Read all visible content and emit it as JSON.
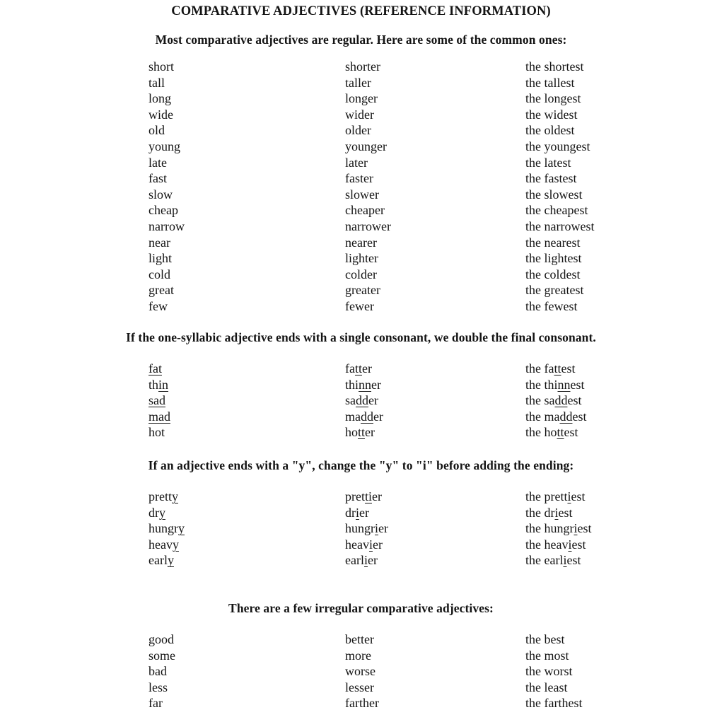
{
  "title": "COMPARATIVE ADJECTIVES (REFERENCE INFORMATION)",
  "sections": [
    {
      "heading": "Most comparative adjectives are regular. Here are some of the common ones:",
      "rows": [
        [
          [
            {
              "t": "short"
            }
          ],
          [
            {
              "t": "shorter"
            }
          ],
          [
            {
              "t": "the shortest"
            }
          ]
        ],
        [
          [
            {
              "t": "tall"
            }
          ],
          [
            {
              "t": "taller"
            }
          ],
          [
            {
              "t": "the tallest"
            }
          ]
        ],
        [
          [
            {
              "t": "long"
            }
          ],
          [
            {
              "t": "longer"
            }
          ],
          [
            {
              "t": "the longest"
            }
          ]
        ],
        [
          [
            {
              "t": "wide"
            }
          ],
          [
            {
              "t": "wider"
            }
          ],
          [
            {
              "t": "the widest"
            }
          ]
        ],
        [
          [
            {
              "t": "old"
            }
          ],
          [
            {
              "t": "older"
            }
          ],
          [
            {
              "t": "the oldest"
            }
          ]
        ],
        [
          [
            {
              "t": "young"
            }
          ],
          [
            {
              "t": "younger"
            }
          ],
          [
            {
              "t": "the youngest"
            }
          ]
        ],
        [
          [
            {
              "t": "late"
            }
          ],
          [
            {
              "t": "later"
            }
          ],
          [
            {
              "t": "the latest"
            }
          ]
        ],
        [
          [
            {
              "t": "fast"
            }
          ],
          [
            {
              "t": "faster"
            }
          ],
          [
            {
              "t": "the fastest"
            }
          ]
        ],
        [
          [
            {
              "t": "slow"
            }
          ],
          [
            {
              "t": "slower"
            }
          ],
          [
            {
              "t": "the slowest"
            }
          ]
        ],
        [
          [
            {
              "t": "cheap"
            }
          ],
          [
            {
              "t": "cheaper"
            }
          ],
          [
            {
              "t": "the cheapest"
            }
          ]
        ],
        [
          [
            {
              "t": "narrow"
            }
          ],
          [
            {
              "t": "narrower"
            }
          ],
          [
            {
              "t": "the narrowest"
            }
          ]
        ],
        [
          [
            {
              "t": "near"
            }
          ],
          [
            {
              "t": "nearer"
            }
          ],
          [
            {
              "t": "the nearest"
            }
          ]
        ],
        [
          [
            {
              "t": "light"
            }
          ],
          [
            {
              "t": "lighter"
            }
          ],
          [
            {
              "t": "the lightest"
            }
          ]
        ],
        [
          [
            {
              "t": "cold"
            }
          ],
          [
            {
              "t": "colder"
            }
          ],
          [
            {
              "t": "the coldest"
            }
          ]
        ],
        [
          [
            {
              "t": "great"
            }
          ],
          [
            {
              "t": "greater"
            }
          ],
          [
            {
              "t": "the greatest"
            }
          ]
        ],
        [
          [
            {
              "t": "few"
            }
          ],
          [
            {
              "t": "fewer"
            }
          ],
          [
            {
              "t": "the fewest"
            }
          ]
        ]
      ]
    },
    {
      "heading": "If the one-syllabic adjective ends with a single consonant, we double the final consonant.",
      "rows": [
        [
          [
            {
              "t": "fat",
              "u": true
            }
          ],
          [
            {
              "t": "fa"
            },
            {
              "t": "tt",
              "u": true
            },
            {
              "t": "er"
            }
          ],
          [
            {
              "t": "the fa"
            },
            {
              "t": "tt",
              "u": true
            },
            {
              "t": "est"
            }
          ]
        ],
        [
          [
            {
              "t": "th"
            },
            {
              "t": "in",
              "u": true
            }
          ],
          [
            {
              "t": "thi"
            },
            {
              "t": "nn",
              "u": true
            },
            {
              "t": "er"
            }
          ],
          [
            {
              "t": "the thi"
            },
            {
              "t": "nn",
              "u": true
            },
            {
              "t": "est"
            }
          ]
        ],
        [
          [
            {
              "t": "sad",
              "u": true
            }
          ],
          [
            {
              "t": "sa"
            },
            {
              "t": "dd",
              "u": true
            },
            {
              "t": "er"
            }
          ],
          [
            {
              "t": "the sa"
            },
            {
              "t": "dd",
              "u": true
            },
            {
              "t": "est"
            }
          ]
        ],
        [
          [
            {
              "t": "mad",
              "u": true
            }
          ],
          [
            {
              "t": "ma"
            },
            {
              "t": "dd",
              "u": true
            },
            {
              "t": "er"
            }
          ],
          [
            {
              "t": "the ma"
            },
            {
              "t": "dd",
              "u": true
            },
            {
              "t": "est"
            }
          ]
        ],
        [
          [
            {
              "t": "hot"
            }
          ],
          [
            {
              "t": "ho"
            },
            {
              "t": "tt",
              "u": true
            },
            {
              "t": "er"
            }
          ],
          [
            {
              "t": "the ho"
            },
            {
              "t": "tt",
              "u": true
            },
            {
              "t": "est"
            }
          ]
        ]
      ]
    },
    {
      "heading": "If an adjective ends with a \"y\", change the \"y\" to \"i\" before adding the ending:",
      "rows": [
        [
          [
            {
              "t": "pretty_prefix",
              "v": "prett"
            },
            {
              "t": "y",
              "u": true
            }
          ],
          [
            {
              "t": "pret"
            },
            {
              "t": "ti",
              "u": true
            },
            {
              "t": "er"
            }
          ],
          [
            {
              "t": "the prett"
            },
            {
              "t": "i",
              "u": true
            },
            {
              "t": "est"
            }
          ]
        ],
        [
          [
            {
              "t": "dr"
            },
            {
              "t": "y",
              "u": true
            }
          ],
          [
            {
              "t": "dr"
            },
            {
              "t": "i",
              "u": true
            },
            {
              "t": "er"
            }
          ],
          [
            {
              "t": "the dr"
            },
            {
              "t": "i",
              "u": true
            },
            {
              "t": "est"
            }
          ]
        ],
        [
          [
            {
              "t": "hungr"
            },
            {
              "t": "y",
              "u": true
            }
          ],
          [
            {
              "t": "hungr"
            },
            {
              "t": "i",
              "u": true
            },
            {
              "t": "er"
            }
          ],
          [
            {
              "t": "the hungr"
            },
            {
              "t": "i",
              "u": true
            },
            {
              "t": "est"
            }
          ]
        ],
        [
          [
            {
              "t": "heav"
            },
            {
              "t": "y",
              "u": true
            }
          ],
          [
            {
              "t": "heav"
            },
            {
              "t": "i",
              "u": true
            },
            {
              "t": "er"
            }
          ],
          [
            {
              "t": "the heav"
            },
            {
              "t": "i",
              "u": true
            },
            {
              "t": "est"
            }
          ]
        ],
        [
          [
            {
              "t": "earl"
            },
            {
              "t": "y",
              "u": true
            }
          ],
          [
            {
              "t": "earl"
            },
            {
              "t": "i",
              "u": true
            },
            {
              "t": "er"
            }
          ],
          [
            {
              "t": "the earl"
            },
            {
              "t": "i",
              "u": true
            },
            {
              "t": "est"
            }
          ]
        ]
      ]
    },
    {
      "heading": "There are a few irregular comparative adjectives:",
      "rows": [
        [
          [
            {
              "t": "good"
            }
          ],
          [
            {
              "t": "better"
            }
          ],
          [
            {
              "t": "the best"
            }
          ]
        ],
        [
          [
            {
              "t": "some"
            }
          ],
          [
            {
              "t": "more"
            }
          ],
          [
            {
              "t": "the most"
            }
          ]
        ],
        [
          [
            {
              "t": "bad"
            }
          ],
          [
            {
              "t": "worse"
            }
          ],
          [
            {
              "t": "the worst"
            }
          ]
        ],
        [
          [
            {
              "t": "less"
            }
          ],
          [
            {
              "t": "lesser"
            }
          ],
          [
            {
              "t": "the least"
            }
          ]
        ],
        [
          [
            {
              "t": "far"
            }
          ],
          [
            {
              "t": "farther"
            }
          ],
          [
            {
              "t": "the farthest"
            }
          ]
        ]
      ]
    }
  ]
}
